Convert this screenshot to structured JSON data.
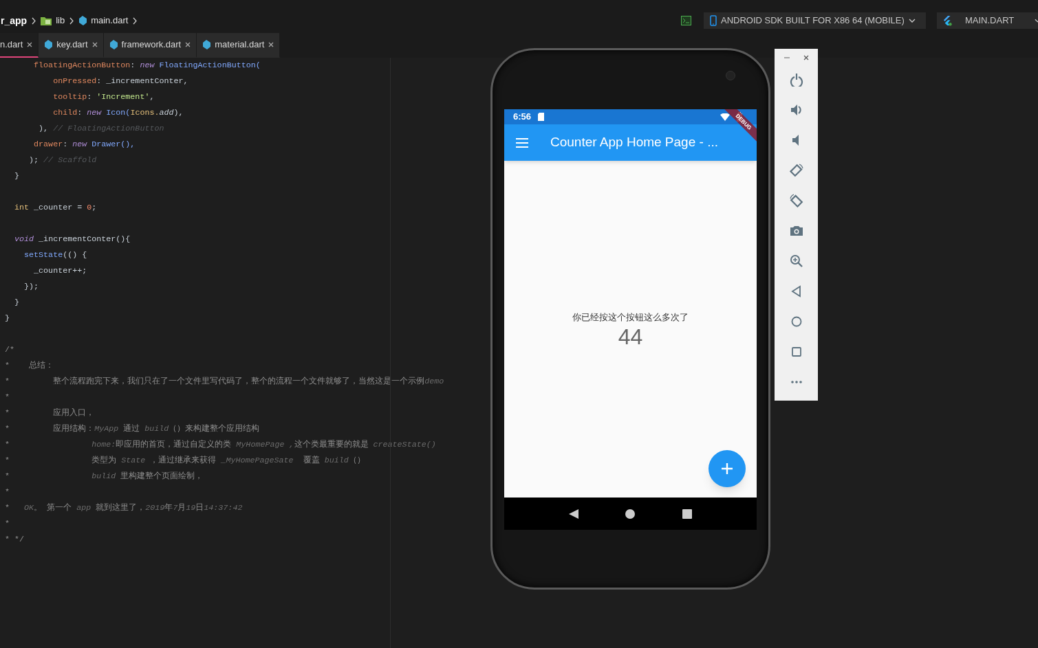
{
  "breadcrumb": {
    "project": "r_app",
    "folder": "lib",
    "file": "main.dart"
  },
  "toolbar": {
    "device": "ANDROID SDK BUILT FOR X86 64 (MOBILE)",
    "run_config": "MAIN.DART"
  },
  "tabs": [
    {
      "label": "n.dart",
      "selected": true
    },
    {
      "label": "key.dart",
      "selected": false
    },
    {
      "label": "framework.dart",
      "selected": false
    },
    {
      "label": "material.dart",
      "selected": false
    }
  ],
  "code_lines": [
    {
      "kind": "code",
      "segments": [
        {
          "kind": "field",
          "text": "      floatingActionButton"
        },
        {
          "kind": "plain",
          "text": ": "
        },
        {
          "kind": "keyword",
          "text": "new"
        },
        {
          "kind": "type",
          "text": " FloatingActionButton("
        }
      ]
    },
    {
      "kind": "code",
      "segments": [
        {
          "kind": "field",
          "text": "          onPressed"
        },
        {
          "kind": "plain",
          "text": ": _incrementConter,"
        }
      ]
    },
    {
      "kind": "code",
      "segments": [
        {
          "kind": "field",
          "text": "          tooltip"
        },
        {
          "kind": "plain",
          "text": ": "
        },
        {
          "kind": "string",
          "text": "'Increment'"
        },
        {
          "kind": "plain",
          "text": ","
        }
      ]
    },
    {
      "kind": "code",
      "segments": [
        {
          "kind": "field",
          "text": "          child"
        },
        {
          "kind": "plain",
          "text": ": "
        },
        {
          "kind": "keyword",
          "text": "new"
        },
        {
          "kind": "type",
          "text": " Icon("
        },
        {
          "kind": "const",
          "text": "Icons."
        },
        {
          "kind": "italic",
          "text": "add"
        },
        {
          "kind": "plain",
          "text": "),"
        }
      ]
    },
    {
      "kind": "code",
      "segments": [
        {
          "kind": "plain",
          "text": "       ), "
        },
        {
          "kind": "comment",
          "text": "// FloatingActionButton"
        }
      ]
    },
    {
      "kind": "code",
      "segments": [
        {
          "kind": "field",
          "text": "      drawer"
        },
        {
          "kind": "plain",
          "text": ": "
        },
        {
          "kind": "keyword",
          "text": "new"
        },
        {
          "kind": "type",
          "text": " Drawer(),"
        }
      ]
    },
    {
      "kind": "code",
      "segments": [
        {
          "kind": "plain",
          "text": "     ); "
        },
        {
          "kind": "comment",
          "text": "// Scaffold"
        }
      ]
    },
    {
      "kind": "code",
      "segments": [
        {
          "kind": "plain",
          "text": "  }"
        }
      ]
    },
    {
      "kind": "blank"
    },
    {
      "kind": "code",
      "segments": [
        {
          "kind": "const",
          "text": "  int"
        },
        {
          "kind": "plain",
          "text": " _counter = "
        },
        {
          "kind": "number",
          "text": "0"
        },
        {
          "kind": "plain",
          "text": ";"
        }
      ]
    },
    {
      "kind": "blank"
    },
    {
      "kind": "code",
      "segments": [
        {
          "kind": "keyword",
          "text": "  void"
        },
        {
          "kind": "plain",
          "text": " _incrementConter(){"
        }
      ]
    },
    {
      "kind": "code",
      "segments": [
        {
          "kind": "type",
          "text": "    setState"
        },
        {
          "kind": "plain",
          "text": "(() {"
        }
      ]
    },
    {
      "kind": "code",
      "segments": [
        {
          "kind": "plain",
          "text": "      _counter++;"
        }
      ]
    },
    {
      "kind": "code",
      "segments": [
        {
          "kind": "plain",
          "text": "    });"
        }
      ]
    },
    {
      "kind": "code",
      "segments": [
        {
          "kind": "plain",
          "text": "  }"
        }
      ]
    },
    {
      "kind": "code",
      "segments": [
        {
          "kind": "plain",
          "text": "}"
        }
      ]
    },
    {
      "kind": "blank"
    },
    {
      "kind": "code",
      "segments": [
        {
          "kind": "doc",
          "text": "/*"
        }
      ]
    },
    {
      "kind": "code",
      "segments": [
        {
          "kind": "doc",
          "text": "*    总结："
        }
      ]
    },
    {
      "kind": "code",
      "segments": [
        {
          "kind": "doc",
          "text": "*         整个流程跑完下来，我们只在了一个文件里写代码了，整个的流程一个文件就够了，当然这是一个示例"
        },
        {
          "kind": "doc_code",
          "text": "demo"
        }
      ]
    },
    {
      "kind": "code",
      "segments": [
        {
          "kind": "doc",
          "text": "*"
        }
      ]
    },
    {
      "kind": "code",
      "segments": [
        {
          "kind": "doc",
          "text": "*         应用入口，"
        }
      ]
    },
    {
      "kind": "code",
      "segments": [
        {
          "kind": "doc",
          "text": "*         应用结构："
        },
        {
          "kind": "doc_code",
          "text": "MyApp"
        },
        {
          "kind": "doc",
          "text": " 通过 "
        },
        {
          "kind": "doc_code",
          "text": "build"
        },
        {
          "kind": "doc",
          "text": "（）来构建整个应用结构"
        }
      ]
    },
    {
      "kind": "code",
      "segments": [
        {
          "kind": "doc",
          "text": "*                 "
        },
        {
          "kind": "doc_code",
          "text": "home:"
        },
        {
          "kind": "doc",
          "text": "即应用的首页，通过自定义的类 "
        },
        {
          "kind": "doc_code",
          "text": "MyHomePage ,"
        },
        {
          "kind": "doc",
          "text": "这个类最重要的就是 "
        },
        {
          "kind": "doc_code",
          "text": "createState()"
        }
      ]
    },
    {
      "kind": "code",
      "segments": [
        {
          "kind": "doc",
          "text": "*                 类型为 "
        },
        {
          "kind": "doc_code",
          "text": "State"
        },
        {
          "kind": "doc",
          "text": " ，通过继承来获得 "
        },
        {
          "kind": "doc_code",
          "text": "_MyHomePageSate"
        },
        {
          "kind": "doc",
          "text": "  覆盖 "
        },
        {
          "kind": "doc_code",
          "text": "build"
        },
        {
          "kind": "doc",
          "text": "（）"
        }
      ]
    },
    {
      "kind": "code",
      "segments": [
        {
          "kind": "doc",
          "text": "*                 "
        },
        {
          "kind": "doc_code",
          "text": "bulid"
        },
        {
          "kind": "doc",
          "text": " 里构建整个页面绘制，"
        }
      ]
    },
    {
      "kind": "code",
      "segments": [
        {
          "kind": "doc",
          "text": "*"
        }
      ]
    },
    {
      "kind": "code",
      "segments": [
        {
          "kind": "doc",
          "text": "*   "
        },
        {
          "kind": "doc_code",
          "text": "OK"
        },
        {
          "kind": "doc",
          "text": "。 第一个 "
        },
        {
          "kind": "doc_code",
          "text": "app"
        },
        {
          "kind": "doc",
          "text": " 就到这里了，"
        },
        {
          "kind": "doc_code",
          "text": "2019"
        },
        {
          "kind": "doc",
          "text": "年"
        },
        {
          "kind": "doc_code",
          "text": "7"
        },
        {
          "kind": "doc",
          "text": "月"
        },
        {
          "kind": "doc_code",
          "text": "19"
        },
        {
          "kind": "doc",
          "text": "日"
        },
        {
          "kind": "doc_code",
          "text": "14:37:42"
        }
      ]
    },
    {
      "kind": "code",
      "segments": [
        {
          "kind": "doc",
          "text": "*"
        }
      ]
    },
    {
      "kind": "code",
      "segments": [
        {
          "kind": "doc",
          "text": "* */"
        }
      ]
    }
  ],
  "emulator": {
    "status_time": "6:56",
    "debug_banner": "DEBUG",
    "app_title": "Counter App Home Page - ...",
    "message": "你已经按这个按钮这么多次了",
    "counter": "44"
  }
}
